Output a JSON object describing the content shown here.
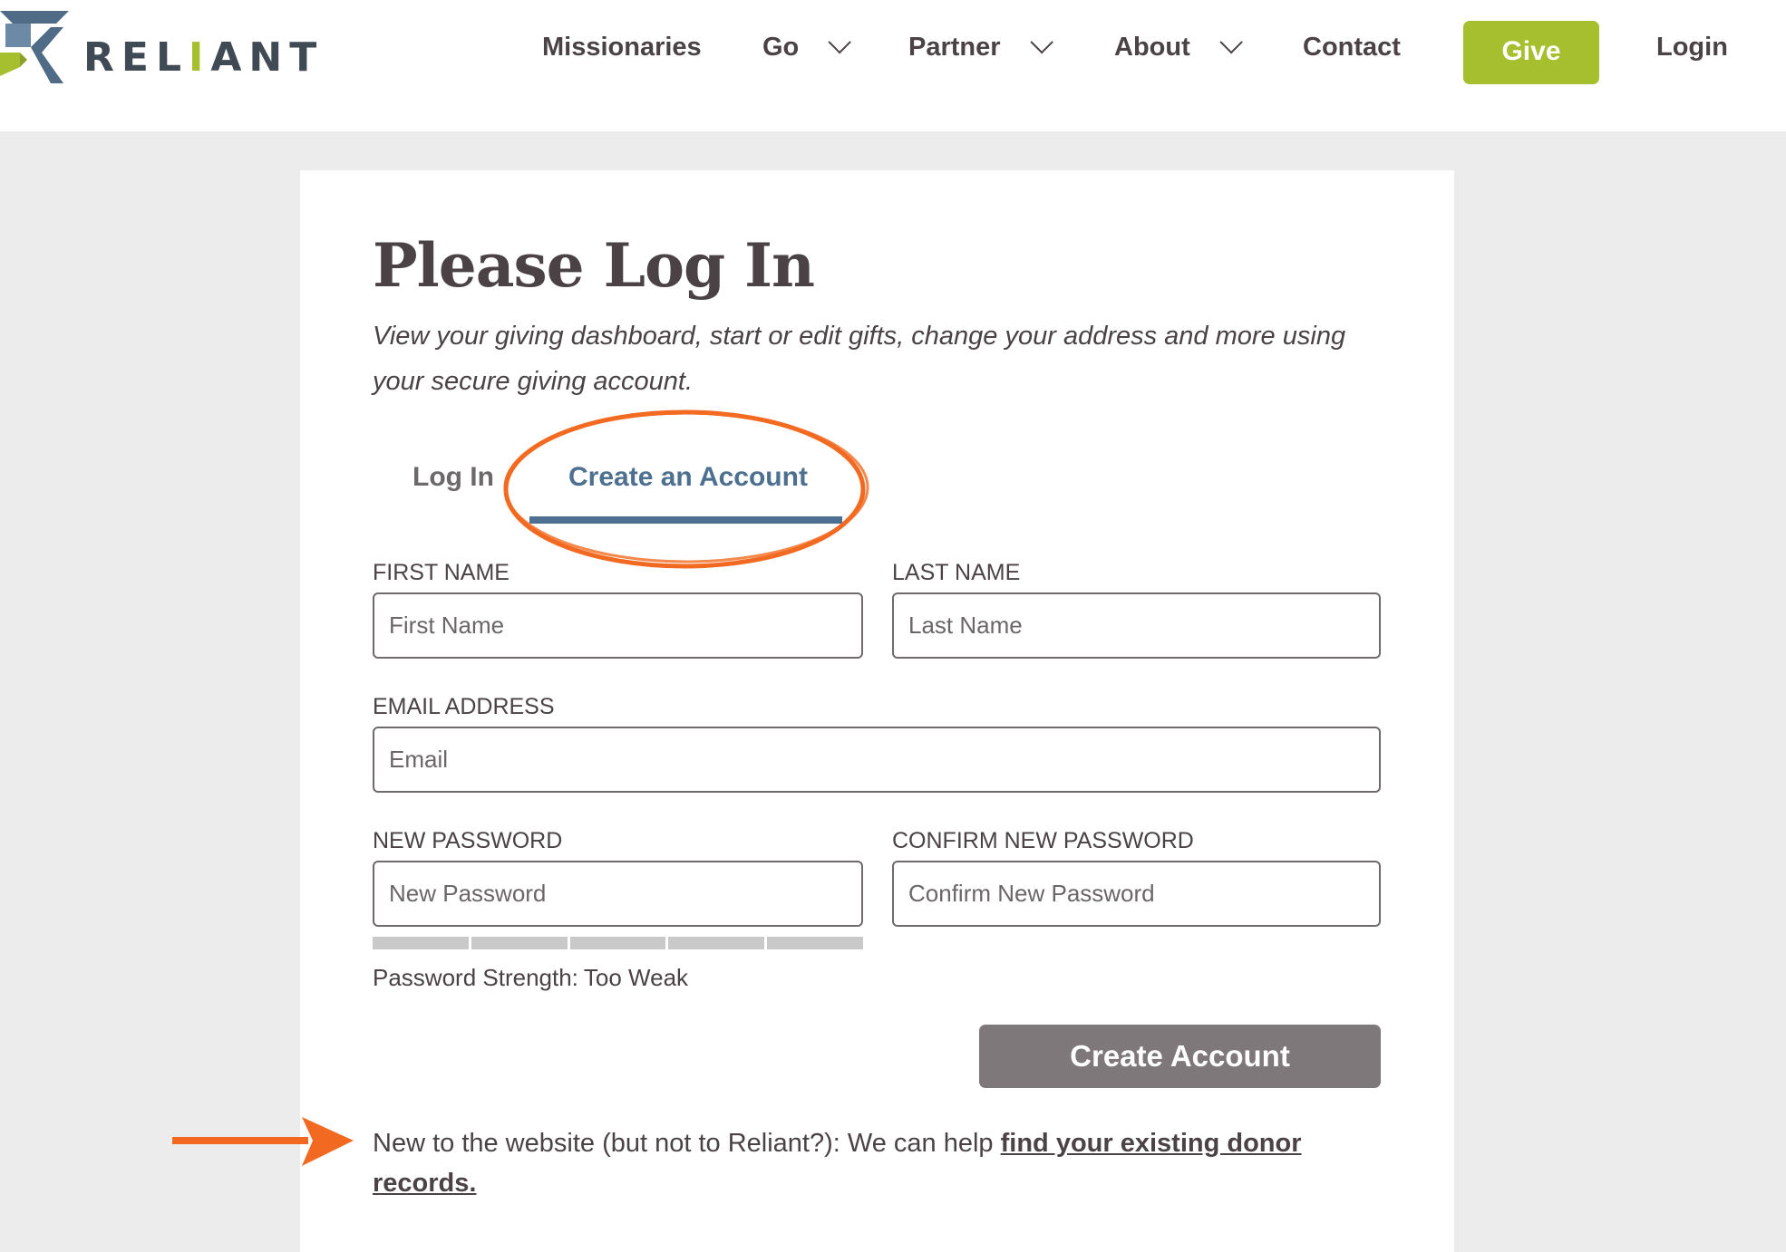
{
  "header": {
    "logo_text_parts": [
      "REL",
      "I",
      "ANT"
    ],
    "brand_colors": {
      "blue": "#4f6b86",
      "green": "#a6bf2f",
      "text": "#3f4a55"
    },
    "nav": [
      {
        "label": "Missionaries",
        "has_dropdown": false
      },
      {
        "label": "Go",
        "has_dropdown": true
      },
      {
        "label": "Partner",
        "has_dropdown": true
      },
      {
        "label": "About",
        "has_dropdown": true
      },
      {
        "label": "Contact",
        "has_dropdown": false
      }
    ],
    "give_label": "Give",
    "login_label": "Login"
  },
  "card": {
    "title": "Please Log In",
    "subtitle": "View your giving dashboard, start or edit gifts, change your address and more using your secure giving account.",
    "tabs": [
      {
        "label": "Log In",
        "active": false
      },
      {
        "label": "Create an Account",
        "active": true
      }
    ],
    "form": {
      "first_name": {
        "label": "FIRST NAME",
        "placeholder": "First Name",
        "value": ""
      },
      "last_name": {
        "label": "LAST NAME",
        "placeholder": "Last Name",
        "value": ""
      },
      "email": {
        "label": "EMAIL ADDRESS",
        "placeholder": "Email",
        "value": ""
      },
      "new_password": {
        "label": "NEW PASSWORD",
        "placeholder": "New Password",
        "value": ""
      },
      "confirm_password": {
        "label": "CONFIRM NEW PASSWORD",
        "placeholder": "Confirm New Password",
        "value": ""
      },
      "password_strength": {
        "label": "Password Strength:",
        "value": "Too Weak",
        "filled_segments": 0,
        "total_segments": 5
      },
      "submit_label": "Create Account"
    },
    "help": {
      "text": "New to the website (but not to Reliant?): We can help ",
      "link_text": "find your existing donor records."
    }
  },
  "colors": {
    "accent_tab": "#4d7090",
    "give_button": "#a6bf2f",
    "submit_button": "#7f787a",
    "annotation": "#f26a21"
  }
}
